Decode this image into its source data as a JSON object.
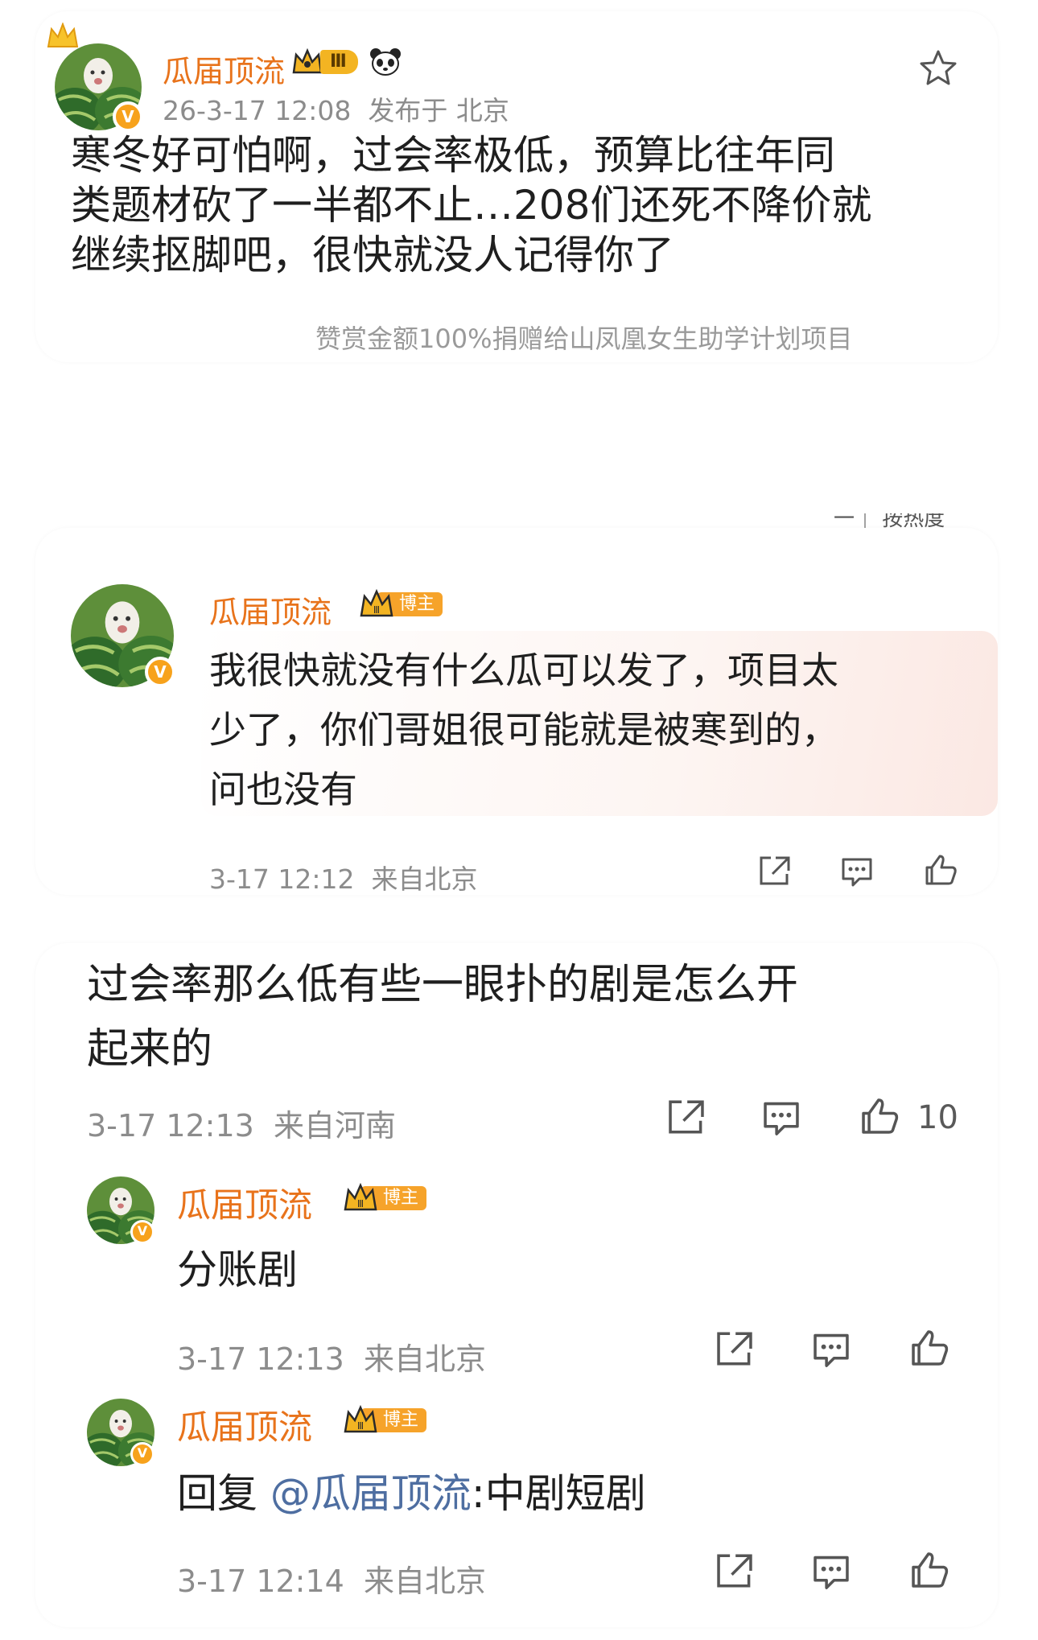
{
  "post": {
    "username": "瓜届顶流",
    "rank_label": "Ⅲ",
    "meta": "26-3-17 12:08  发布于 北京",
    "body": "寒冬好可怕啊，过会率极低，预算比往年同类题材砍了一半都不止…208们还死不降价就继续抠脚吧，很快就没人记得你了",
    "body_line1": "寒冬好可怕啊，过会率极低，预算比往年同",
    "body_line2": "类题材砍了一半都不止…208们还死不降价就",
    "body_line3": "继续抠脚吧，很快就没人记得你了",
    "donation_note": "赞赏金额100%捐赠给山凤凰女生助学计划项目",
    "cut_label": "一｜  按热度"
  },
  "host_reply": {
    "username": "瓜届顶流",
    "tag": "博主",
    "rank_label": "Ⅲ",
    "line1": "我很快就没有什么瓜可以发了，项目太",
    "line2": "少了，你们哥姐很可能就是被寒到的，",
    "line3": "问也没有",
    "meta": "3-17 12:12  来自北京"
  },
  "comment": {
    "line1": "过会率那么低有些一眼扑的剧是怎么开",
    "line2": "起来的",
    "meta": "3-17 12:13  来自河南",
    "like_count": "10"
  },
  "replies": [
    {
      "username": "瓜届顶流",
      "tag": "博主",
      "rank_label": "Ⅲ",
      "text": "分账剧",
      "meta": "3-17 12:13  来自北京"
    },
    {
      "username": "瓜届顶流",
      "tag": "博主",
      "rank_label": "Ⅲ",
      "reply_prefix": "回复",
      "mention": "@瓜届顶流",
      "text": ":中剧短剧",
      "meta": "3-17 12:14  来自北京"
    }
  ],
  "colors": {
    "username": "#e8731b",
    "meta": "#8c8c8c",
    "badge": "#f6a32a",
    "mention": "#4e6ea1",
    "highlight_bubble": "#fdf1ee"
  },
  "icons": [
    "crown-icon",
    "verified-icon",
    "panda-icon",
    "star-icon",
    "share-icon",
    "comment-icon",
    "like-icon"
  ]
}
